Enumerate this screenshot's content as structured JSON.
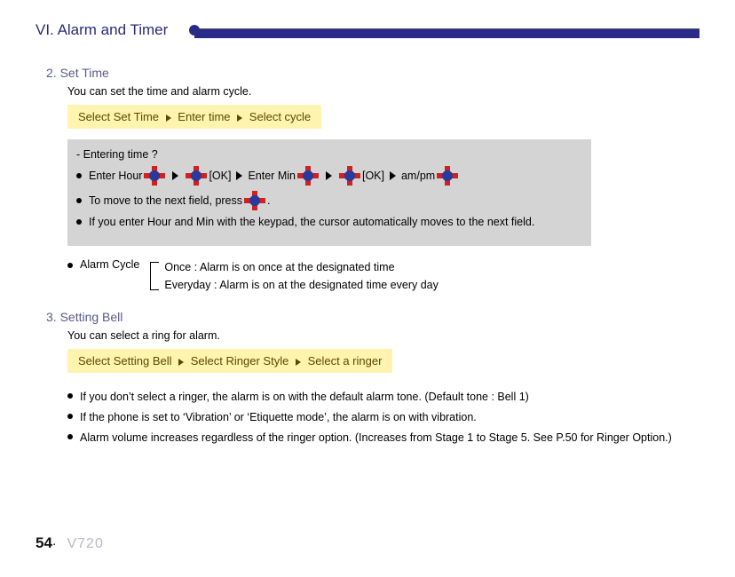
{
  "header": {
    "title": "VI. Alarm and Timer"
  },
  "sec2": {
    "title": "2. Set Time",
    "desc": "You can set the time and alarm cycle.",
    "yellow": {
      "p1": "Select Set Time",
      "p2": "Enter time",
      "p3": "Select cycle"
    },
    "gray": {
      "question": "- Entering time ?",
      "enter_hour": "Enter Hour",
      "ok1": "[OK]",
      "enter_min": "Enter Min",
      "ok2": "[OK]",
      "ampm": "am/pm",
      "move_next_pre": "To move to the next field, press",
      "move_next_post": ".",
      "auto_move": "If you enter Hour and Min with the keypad, the cursor automatically moves to the next field."
    },
    "cycle": {
      "label": "Alarm Cycle",
      "once": "Once : Alarm is on once at the designated time",
      "everyday": "Everyday : Alarm is on at the designated time every day"
    }
  },
  "sec3": {
    "title": "3. Setting Bell",
    "desc": "You can select a ring for alarm.",
    "yellow": {
      "p1": "Select Setting Bell",
      "p2": "Select Ringer Style",
      "p3": "Select a ringer"
    },
    "bullets": {
      "b1": "If you don’t select a ringer, the alarm is on with the default alarm tone. (Default tone : Bell 1)",
      "b2": " If the phone is set to ‘Vibration’ or ‘Etiquette mode’, the alarm is on with vibration.",
      "b3": "Alarm volume increases regardless of the ringer option. (Increases from Stage 1 to Stage 5. See P.50 for Ringer Option.)"
    }
  },
  "footer": {
    "page": "54",
    "sep": "·",
    "model": "V720"
  }
}
